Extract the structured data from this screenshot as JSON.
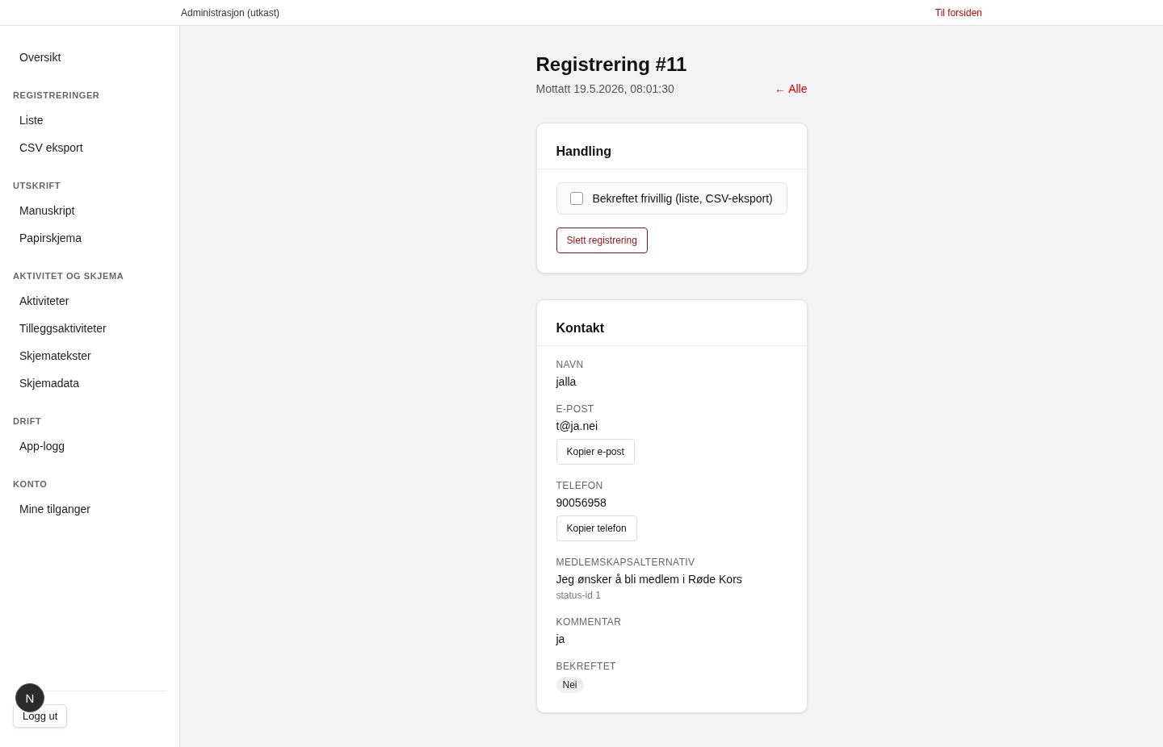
{
  "topbar": {
    "title": "Administrasjon (utkast)",
    "home_link": "Til forsiden"
  },
  "sidebar": {
    "sections": [
      {
        "items": [
          {
            "label": "Oversikt",
            "selected": false
          }
        ]
      },
      {
        "heading": "REGISTRERINGER",
        "items": [
          {
            "label": "Liste",
            "selected": false
          },
          {
            "label": "CSV eksport",
            "selected": false
          }
        ]
      },
      {
        "heading": "UTSKRIFT",
        "items": [
          {
            "label": "Manuskript",
            "selected": false
          },
          {
            "label": "Papirskjema",
            "selected": false
          }
        ]
      },
      {
        "heading": "AKTIVITET OG SKJEMA",
        "items": [
          {
            "label": "Aktiviteter",
            "selected": false
          },
          {
            "label": "Tilleggsaktiviteter",
            "selected": false
          },
          {
            "label": "Skjematekster",
            "selected": false
          },
          {
            "label": "Skjemadata",
            "selected": false
          }
        ]
      },
      {
        "heading": "DRIFT",
        "items": [
          {
            "label": "App-logg",
            "selected": false
          }
        ]
      },
      {
        "heading": "KONTO",
        "items": [
          {
            "label": "Mine tilganger",
            "selected": false
          }
        ]
      }
    ],
    "logout": "Logg ut",
    "dev_badge": "N"
  },
  "page": {
    "title": "Registrering #11",
    "received": "Mottatt 19.5.2026, 08:01:30",
    "back_link": "← Alle"
  },
  "action_card": {
    "title": "Handling",
    "checkbox": {
      "label": "Bekreftet frivillig (liste, CSV-eksport)",
      "checked": false
    },
    "delete_button": "Slett registrering"
  },
  "contact_card": {
    "title": "Kontakt",
    "fields": [
      {
        "label": "NAVN",
        "value": "jalla"
      },
      {
        "label": "E-POST",
        "value": "t@ja.nei",
        "button": "Kopier e-post"
      },
      {
        "label": "TELEFON",
        "value": "90056958",
        "button": "Kopier telefon"
      },
      {
        "label": "MEDLEMSKAPSALTERNATIV",
        "value": "Jeg ønsker å bli medlem i Røde Kors",
        "note": "status-id 1"
      },
      {
        "label": "KOMMENTAR",
        "value": "ja"
      },
      {
        "label": "BEKREFTET",
        "badge": "Nei"
      }
    ]
  }
}
